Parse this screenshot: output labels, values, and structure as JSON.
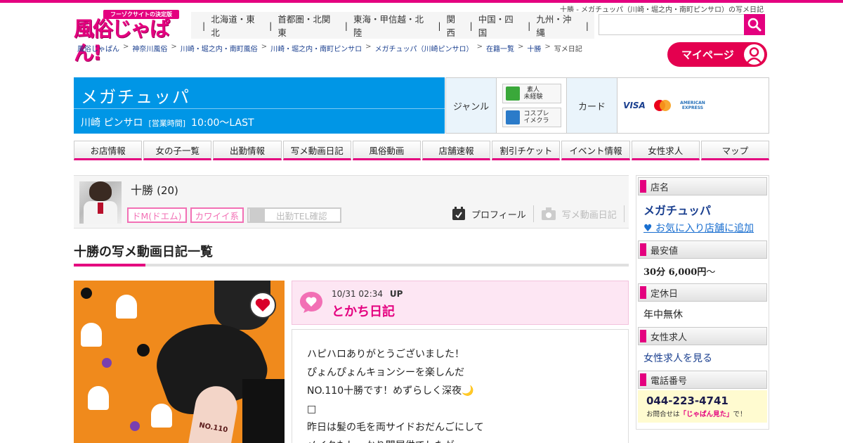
{
  "page_heading": "十勝 - メガチュッパ（川崎・堀之内・南町ピンサロ）の写メ日記",
  "logo": {
    "tagline": "フーゾクサイトの決定版",
    "text": "風俗じゃぱん!"
  },
  "region_nav": [
    "北海道・東北",
    "首都圏・北関東",
    "東海・甲信越・北陸",
    "関西",
    "中国・四国",
    "九州・沖縄"
  ],
  "search": {
    "placeholder": ""
  },
  "breadcrumb": [
    "風俗じゃぱん",
    "神奈川風俗",
    "川崎・堀之内・南町風俗",
    "川崎・堀之内・南町ピンサロ",
    "メガチュッパ（川崎ピンサロ）",
    "在籍一覧",
    "十勝"
  ],
  "breadcrumb_current": "写メ日記",
  "mypage_label": "マイページ",
  "shop": {
    "name": "メガチュッパ",
    "area": "川崎 ピンサロ",
    "hours_label": "[営業時間]",
    "hours": "10:00～LAST"
  },
  "info": {
    "genre_label": "ジャンル",
    "genres": [
      {
        "line1": "素人",
        "line2": "未経験",
        "color": "#3aa83a"
      },
      {
        "line1": "コスプレ",
        "line2": "イメクラ",
        "color": "#2b7bc9"
      }
    ],
    "card_label": "カード",
    "cards": [
      "VISA",
      "MC",
      "AMERICAN EXPRESS"
    ]
  },
  "main_nav": [
    "お店情報",
    "女の子一覧",
    "出勤情報",
    "写メ動画日記",
    "風俗動画",
    "店舗速報",
    "割引チケット",
    "イベント情報",
    "女性求人",
    "マップ"
  ],
  "profile": {
    "name": "十勝",
    "age": "(20)",
    "tags": [
      "ドM(ドエム)",
      "カワイイ系"
    ],
    "tel_check": "出勤TEL確認",
    "profile_link": "プロフィール",
    "diary_link": "写メ動画日記"
  },
  "section_title": "十勝の写メ動画日記一覧",
  "diary": {
    "date": "10/31",
    "time": "02:34",
    "up": "UP",
    "title": "とかち日記",
    "photo_number": "NO.110",
    "lines": [
      "ハピハロありがとうございました！",
      "ぴょんぴょんキョンシーを楽しんだ",
      "NO.110十勝です！めずらしく深夜🌙",
      "□",
      "昨日は髪の毛を両サイドおだんごにして",
      "メイクもしっかり間屋供でしたが"
    ]
  },
  "sidebar": {
    "shop_label": "店名",
    "shop_name": "メガチュッパ",
    "fav_link": "♥ お気に入り店舗に追加",
    "price_label": "最安値",
    "price": "30分 6,000円",
    "price_suffix": "～",
    "holiday_label": "定休日",
    "holiday": "年中無休",
    "recruit_label": "女性求人",
    "recruit_link": "女性求人を見る",
    "tel_label": "電話番号",
    "tel": "044-223-4741",
    "tel_note_prefix": "お問合せは",
    "tel_note_em": "「じゃぱん見た」",
    "tel_note_suffix": "で！"
  },
  "colors": {
    "accent": "#e4007f",
    "shop_header": "#0096e6",
    "link": "#1a3f8f"
  }
}
